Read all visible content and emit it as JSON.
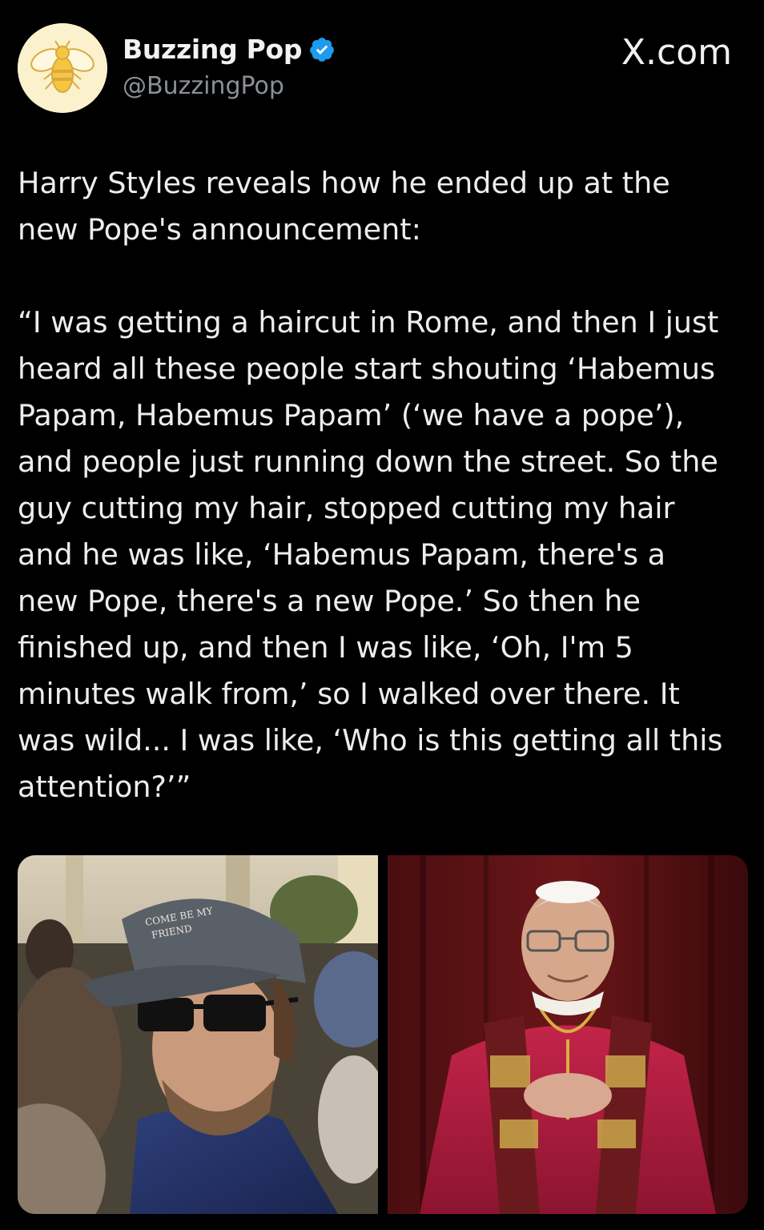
{
  "account": {
    "display_name": "Buzzing Pop",
    "handle": "@BuzzingPop",
    "avatar_icon": "bee-icon",
    "verified_icon": "verified-badge-icon",
    "verified_color": "#1d9bf0"
  },
  "watermark": {
    "site": "X.com"
  },
  "tweet": {
    "text": "Harry Styles reveals how he ended up at the\nnew Pope's announcement:\n\n“I was getting a haircut in Rome, and then I just\nheard all these people start shouting ‘Habemus\nPapam, Habemus Papam’ (‘we have a pope’),\nand people just running down the street. So the\nguy cutting my hair, stopped cutting my hair\nand he was like, ‘Habemus Papam, there's a\nnew Pope, there's a new Pope.’ So then he\nfinished up, and then I was like, ‘Oh, I'm 5\nminutes walk from,’ so I walked over there. It\nwas wild... I was like, ‘Who is this getting all this\nattention?’”"
  },
  "media": {
    "left_photo": "man-in-cap-and-sunglasses-in-crowd",
    "right_photo": "pope-in-red-vestments-on-balcony",
    "cap_text": "COME BE MY FRIEND"
  }
}
